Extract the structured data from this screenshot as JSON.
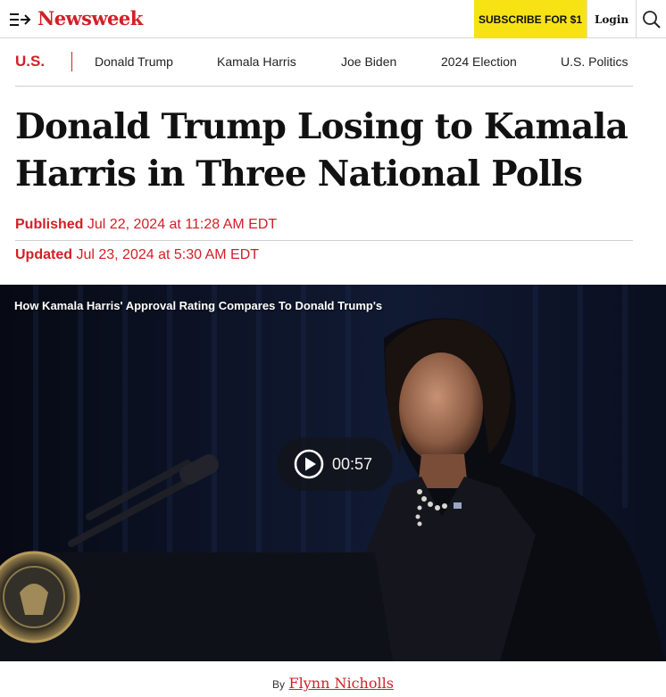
{
  "header": {
    "logo_text": "Newsweek",
    "subscribe_label": "SUBSCRIBE FOR $1",
    "login_label": "Login",
    "brand_color": "#d12027",
    "subscribe_color": "#f7e214",
    "menu_icon": "menu-arrow-icon",
    "search_icon": "search-icon"
  },
  "section_nav": {
    "section_label": "U.S.",
    "links": [
      "Donald Trump",
      "Kamala Harris",
      "Joe Biden",
      "2024 Election",
      "U.S. Politics"
    ]
  },
  "article": {
    "headline_line1": "Donald Trump Losing to Kamala",
    "headline_line2": "Harris in Three National Polls",
    "published_label": "Published",
    "published_date": "Jul 22, 2024 at 11:28 AM EDT",
    "updated_label": "Updated",
    "updated_date": "Jul 23, 2024 at 5:30 AM EDT",
    "byline_prefix": "By",
    "author": "Flynn Nicholls"
  },
  "video": {
    "title": "How Kamala Harris' Approval Rating Compares To Donald Trump's",
    "duration": "00:57",
    "play_icon": "play-circle-icon"
  }
}
